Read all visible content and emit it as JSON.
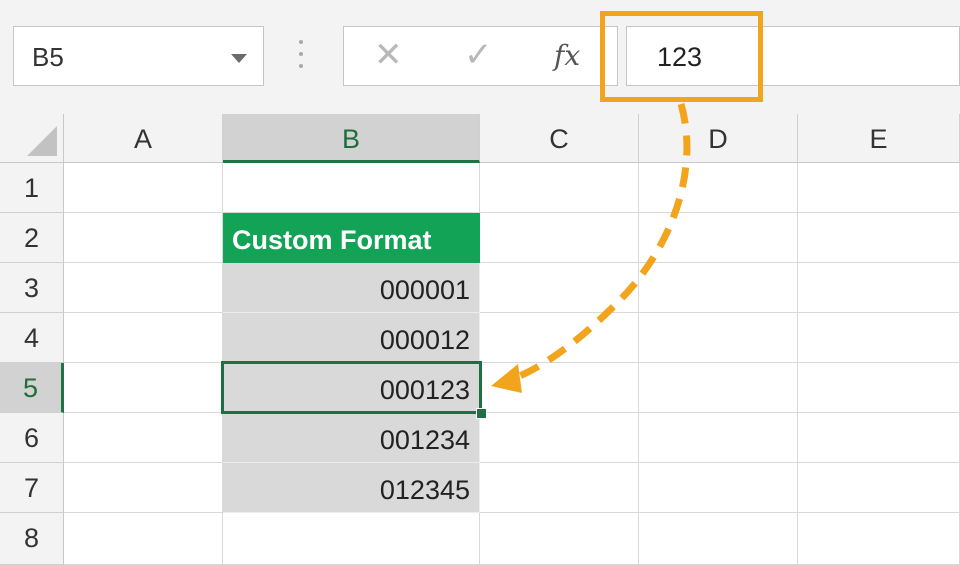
{
  "formula_bar": {
    "name_box": "B5",
    "cancel_glyph": "✕",
    "enter_glyph": "✓",
    "fx_label": "fx",
    "formula_value": "123"
  },
  "columns": [
    "A",
    "B",
    "C",
    "D",
    "E"
  ],
  "rows": [
    "1",
    "2",
    "3",
    "4",
    "5",
    "6",
    "7",
    "8"
  ],
  "selected": {
    "column": "B",
    "row": "5",
    "cell": "B5"
  },
  "cells": {
    "B2": "Custom Format",
    "B3": "000001",
    "B4": "000012",
    "B5": "000123",
    "B6": "001234",
    "B7": "012345"
  },
  "colors": {
    "header_fill": "#12a356",
    "data_fill": "#d9d9d9",
    "selection": "#1d7044",
    "callout": "#f2a51c"
  }
}
